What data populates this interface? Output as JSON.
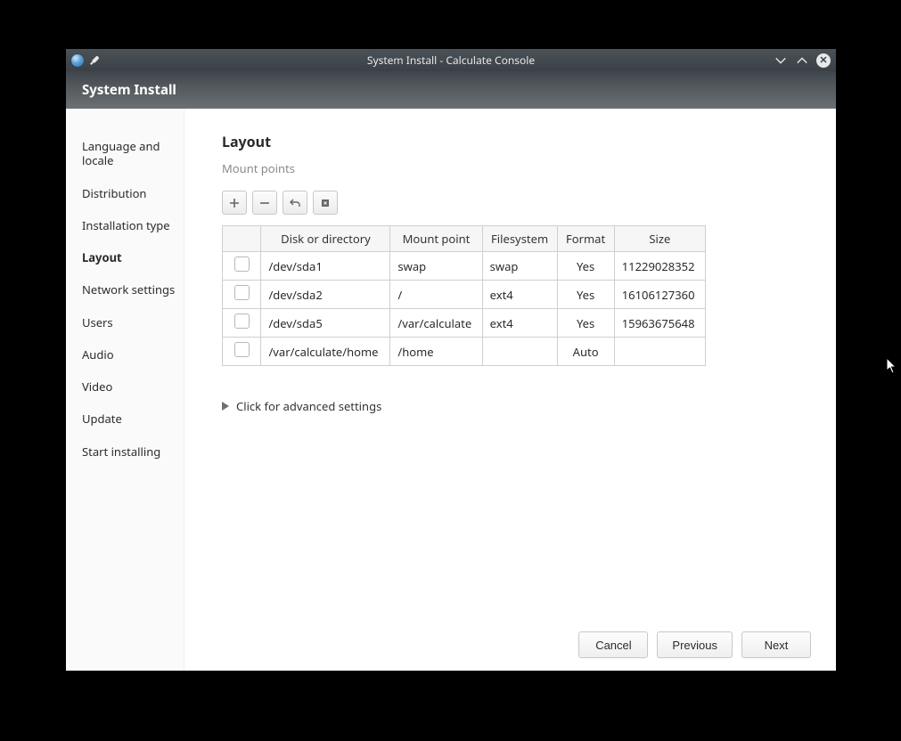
{
  "window": {
    "title": "System Install - Calculate Console",
    "header_title": "System Install"
  },
  "sidebar": {
    "items": [
      {
        "label": "Language and locale",
        "active": false
      },
      {
        "label": "Distribution",
        "active": false
      },
      {
        "label": "Installation type",
        "active": false
      },
      {
        "label": "Layout",
        "active": true
      },
      {
        "label": "Network settings",
        "active": false
      },
      {
        "label": "Users",
        "active": false
      },
      {
        "label": "Audio",
        "active": false
      },
      {
        "label": "Video",
        "active": false
      },
      {
        "label": "Update",
        "active": false
      },
      {
        "label": "Start installing",
        "active": false
      }
    ]
  },
  "main": {
    "title": "Layout",
    "subtitle": "Mount points",
    "advanced_label": "Click for advanced settings",
    "table": {
      "headers": {
        "checkbox": "",
        "disk": "Disk or directory",
        "mount": "Mount point",
        "fs": "Filesystem",
        "format": "Format",
        "size": "Size"
      },
      "rows": [
        {
          "disk": "/dev/sda1",
          "mount": "swap",
          "fs": "swap",
          "format": "Yes",
          "size": "11229028352"
        },
        {
          "disk": "/dev/sda2",
          "mount": "/",
          "fs": "ext4",
          "format": "Yes",
          "size": "16106127360"
        },
        {
          "disk": "/dev/sda5",
          "mount": "/var/calculate",
          "fs": "ext4",
          "format": "Yes",
          "size": "15963675648"
        },
        {
          "disk": "/var/calculate/home",
          "mount": "/home",
          "fs": "",
          "format": "Auto",
          "size": ""
        }
      ]
    }
  },
  "footer": {
    "cancel": "Cancel",
    "previous": "Previous",
    "next": "Next"
  }
}
